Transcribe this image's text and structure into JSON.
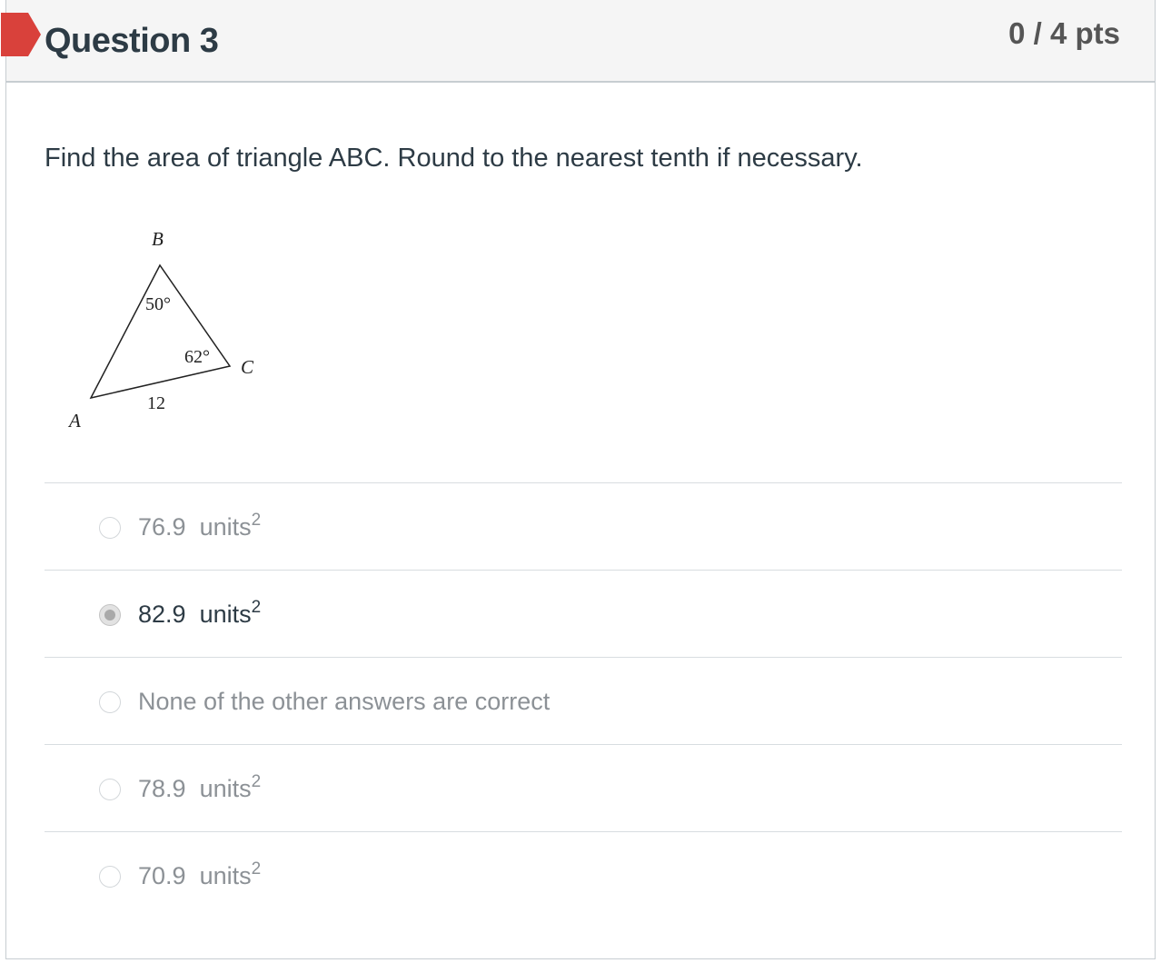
{
  "question": {
    "title": "Question 3",
    "points": "0 / 4 pts",
    "prompt": "Find the area of triangle ABC. Round to the nearest tenth if necessary."
  },
  "figure": {
    "vertex_a": "A",
    "vertex_b": "B",
    "vertex_c": "C",
    "angle_b": "50°",
    "angle_c": "62°",
    "side_ac": "12"
  },
  "answers": [
    {
      "value": "76.9",
      "unit": "units",
      "exponent": "2",
      "selected": false
    },
    {
      "value": "82.9",
      "unit": "units",
      "exponent": "2",
      "selected": true
    },
    {
      "value": "None of the other answers are correct",
      "unit": "",
      "exponent": "",
      "selected": false
    },
    {
      "value": "78.9",
      "unit": "units",
      "exponent": "2",
      "selected": false
    },
    {
      "value": "70.9",
      "unit": "units",
      "exponent": "2",
      "selected": false
    }
  ],
  "colors": {
    "flag": "#d9413b",
    "title": "#2d3b45",
    "header_bg": "#f5f5f5",
    "muted_text": "#8c9196"
  }
}
